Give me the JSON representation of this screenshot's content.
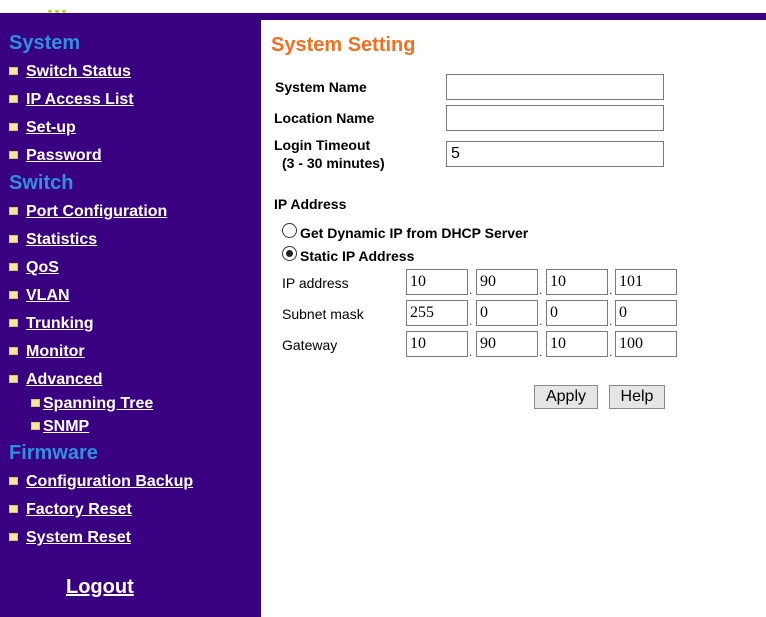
{
  "sidebar": {
    "sections": [
      "System",
      "Switch",
      "Firmware"
    ],
    "system_items": [
      "Switch Status",
      "IP Access List",
      "Set-up",
      "Password"
    ],
    "switch_items": [
      "Port Configuration",
      "Statistics",
      "QoS",
      "VLAN",
      "Trunking",
      "Monitor",
      "Advanced"
    ],
    "advanced_items": [
      "Spanning Tree",
      "SNMP"
    ],
    "firmware_items": [
      "Configuration Backup",
      "Factory Reset",
      "System Reset"
    ],
    "logout": "Logout"
  },
  "main": {
    "title": "System Setting",
    "system_name_label": "System Name",
    "system_name_value": "",
    "location_name_label": "Location Name",
    "location_name_value": "",
    "login_timeout_label": "Login Timeout",
    "login_timeout_hint": "(3 - 30 minutes)",
    "login_timeout_value": "5",
    "ip_section_label": "IP Address",
    "dhcp_option": "Get Dynamic IP from DHCP Server",
    "static_option": "Static IP Address",
    "selected_mode": "static",
    "ip_address_label": "IP address",
    "ip_address": [
      "10",
      "90",
      "10",
      "101"
    ],
    "subnet_label": "Subnet mask",
    "subnet": [
      "255",
      "0",
      "0",
      "0"
    ],
    "gateway_label": "Gateway",
    "gateway": [
      "10",
      "90",
      "10",
      "100"
    ],
    "apply_label": "Apply",
    "help_label": "Help"
  },
  "colors": {
    "sidebar_bg": "#3a0082",
    "section_heading": "#2f8fe0",
    "title_accent": "#f4701e",
    "bullet": "#f3e79a"
  }
}
